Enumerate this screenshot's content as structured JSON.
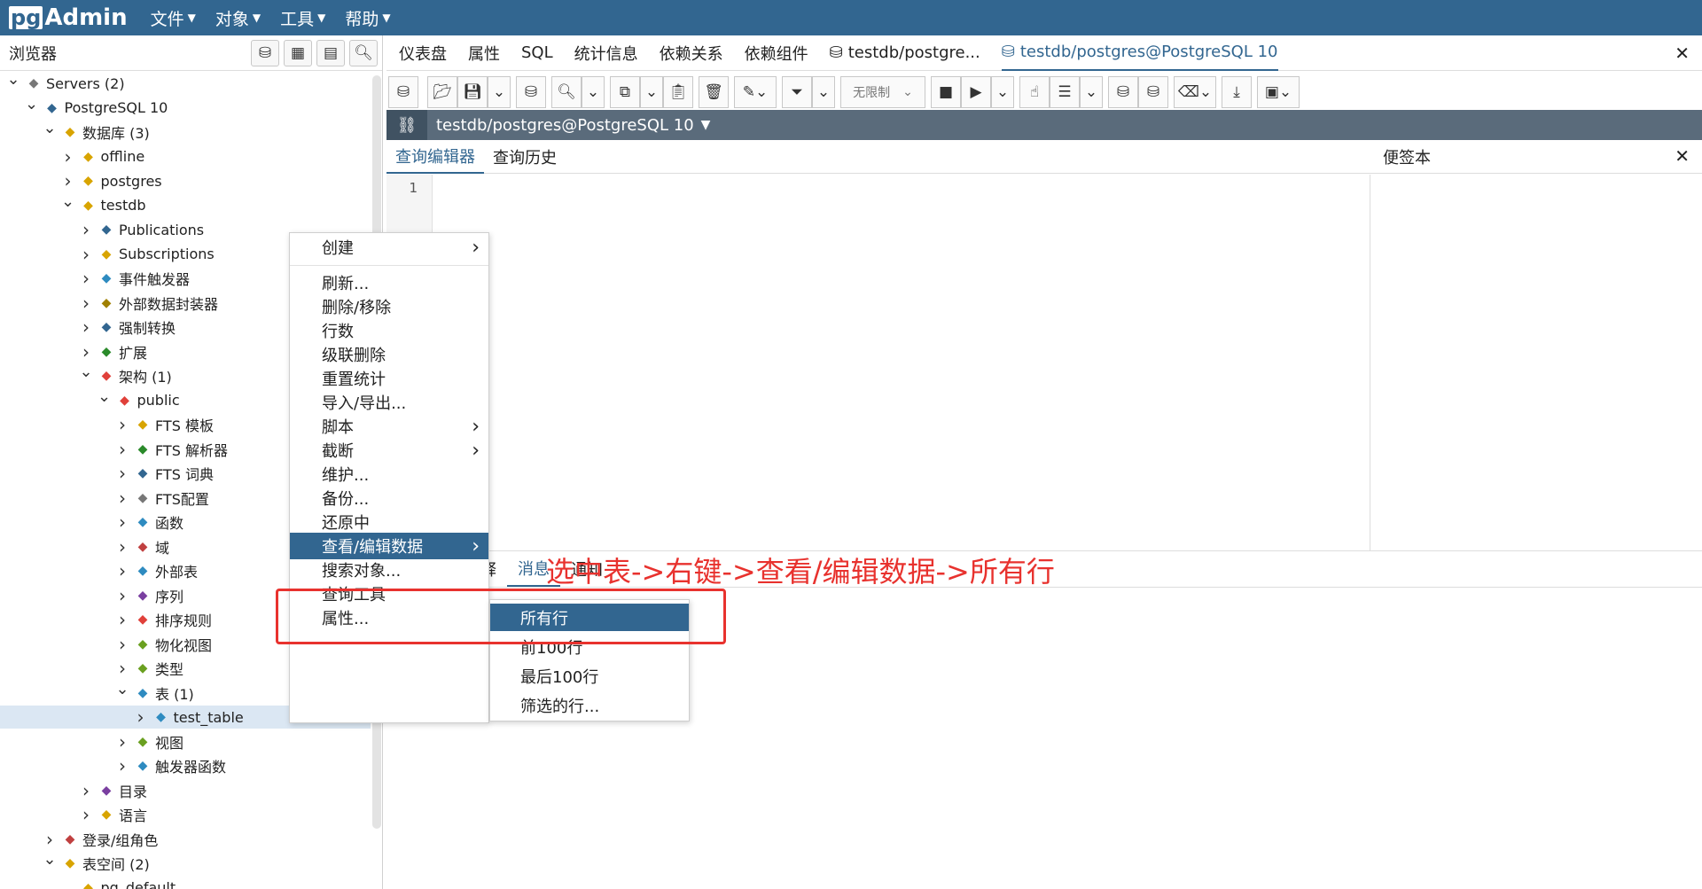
{
  "app": {
    "logo_pg": "pg",
    "logo_admin": "Admin"
  },
  "menu": [
    "文件",
    "对象",
    "工具",
    "帮助"
  ],
  "browser": {
    "title": "浏览器",
    "tree": [
      {
        "label": "Servers (2)",
        "level": 0,
        "exp": "open",
        "icon": "servers-icon",
        "color": "#777"
      },
      {
        "label": "PostgreSQL 10",
        "level": 1,
        "exp": "open",
        "icon": "elephant-icon",
        "color": "#326690"
      },
      {
        "label": "数据库 (3)",
        "level": 2,
        "exp": "open",
        "icon": "databases-icon",
        "color": "#d8a400"
      },
      {
        "label": "offline",
        "level": 3,
        "exp": "closed",
        "icon": "database-icon",
        "color": "#d8a400"
      },
      {
        "label": "postgres",
        "level": 3,
        "exp": "closed",
        "icon": "database-icon",
        "color": "#d8a400"
      },
      {
        "label": "testdb",
        "level": 3,
        "exp": "open",
        "icon": "database-icon",
        "color": "#d8a400"
      },
      {
        "label": "Publications",
        "level": 4,
        "exp": "closed",
        "icon": "publication-icon",
        "color": "#326690"
      },
      {
        "label": "Subscriptions",
        "level": 4,
        "exp": "closed",
        "icon": "subscription-icon",
        "color": "#d8a400"
      },
      {
        "label": "事件触发器",
        "level": 4,
        "exp": "closed",
        "icon": "event-trigger-icon",
        "color": "#2e8bc0"
      },
      {
        "label": "外部数据封装器",
        "level": 4,
        "exp": "closed",
        "icon": "fdw-icon",
        "color": "#a08000"
      },
      {
        "label": "强制转换",
        "level": 4,
        "exp": "closed",
        "icon": "cast-icon",
        "color": "#326690"
      },
      {
        "label": "扩展",
        "level": 4,
        "exp": "closed",
        "icon": "extension-icon",
        "color": "#2a8a2a"
      },
      {
        "label": "架构 (1)",
        "level": 4,
        "exp": "open",
        "icon": "schemas-icon",
        "color": "#e0403a"
      },
      {
        "label": "public",
        "level": 5,
        "exp": "open",
        "icon": "schema-icon",
        "color": "#e0403a"
      },
      {
        "label": "FTS 模板",
        "level": 6,
        "exp": "closed",
        "icon": "fts-template-icon",
        "color": "#d8a400"
      },
      {
        "label": "FTS 解析器",
        "level": 6,
        "exp": "closed",
        "icon": "fts-parser-icon",
        "color": "#2a8a2a"
      },
      {
        "label": "FTS 词典",
        "level": 6,
        "exp": "closed",
        "icon": "fts-dictionary-icon",
        "color": "#326690"
      },
      {
        "label": "FTS配置",
        "level": 6,
        "exp": "closed",
        "icon": "fts-config-icon",
        "color": "#777"
      },
      {
        "label": "函数",
        "level": 6,
        "exp": "closed",
        "icon": "function-icon",
        "color": "#2e8bc0"
      },
      {
        "label": "域",
        "level": 6,
        "exp": "closed",
        "icon": "domain-icon",
        "color": "#c04040"
      },
      {
        "label": "外部表",
        "level": 6,
        "exp": "closed",
        "icon": "foreign-table-icon",
        "color": "#2e8bc0"
      },
      {
        "label": "序列",
        "level": 6,
        "exp": "closed",
        "icon": "sequence-icon",
        "color": "#7a3fa0"
      },
      {
        "label": "排序规则",
        "level": 6,
        "exp": "closed",
        "icon": "collation-icon",
        "color": "#e0403a"
      },
      {
        "label": "物化视图",
        "level": 6,
        "exp": "closed",
        "icon": "materialized-view-icon",
        "color": "#6aa020"
      },
      {
        "label": "类型",
        "level": 6,
        "exp": "closed",
        "icon": "type-icon",
        "color": "#6aa020"
      },
      {
        "label": "表 (1)",
        "level": 6,
        "exp": "open",
        "icon": "tables-icon",
        "color": "#2e8bc0"
      },
      {
        "label": "test_table",
        "level": 7,
        "exp": "closed",
        "icon": "table-icon",
        "color": "#2e8bc0",
        "selected": true
      },
      {
        "label": "视图",
        "level": 6,
        "exp": "closed",
        "icon": "view-icon",
        "color": "#6aa020"
      },
      {
        "label": "触发器函数",
        "level": 6,
        "exp": "closed",
        "icon": "trigger-function-icon",
        "color": "#2e8bc0"
      },
      {
        "label": "目录",
        "level": 4,
        "exp": "closed",
        "icon": "catalog-icon",
        "color": "#7a3fa0"
      },
      {
        "label": "语言",
        "level": 4,
        "exp": "closed",
        "icon": "language-icon",
        "color": "#d8a400"
      },
      {
        "label": "登录/组角色",
        "level": 2,
        "exp": "closed",
        "icon": "roles-icon",
        "color": "#c04040"
      },
      {
        "label": "表空间 (2)",
        "level": 2,
        "exp": "open",
        "icon": "tablespaces-icon",
        "color": "#d8a400"
      },
      {
        "label": "pg_default",
        "level": 3,
        "exp": "none",
        "icon": "tablespace-icon",
        "color": "#d8a400"
      }
    ]
  },
  "tabs": [
    "仪表盘",
    "属性",
    "SQL",
    "统计信息",
    "依赖关系",
    "依赖组件",
    "testdb/postgre...",
    "testdb/postgres@PostgreSQL 10"
  ],
  "toolbar": {
    "limit_label": "无限制"
  },
  "connection": {
    "label": "testdb/postgres@PostgreSQL 10"
  },
  "query_tabs": [
    "查询编辑器",
    "查询历史"
  ],
  "scratch": {
    "title": "便签本"
  },
  "editor": {
    "line_number": "1"
  },
  "bottom_tabs": [
    "释",
    "消息",
    "通知"
  ],
  "context_menu": [
    {
      "label": "创建",
      "sub": true
    },
    {
      "label": "刷新...",
      "sub": false
    },
    {
      "label": "删除/移除",
      "sub": false
    },
    {
      "label": "行数",
      "sub": false
    },
    {
      "label": "级联删除",
      "sub": false
    },
    {
      "label": "重置统计",
      "sub": false
    },
    {
      "label": "导入/导出...",
      "sub": false
    },
    {
      "label": "脚本",
      "sub": true
    },
    {
      "label": "截断",
      "sub": true
    },
    {
      "label": "维护...",
      "sub": false
    },
    {
      "label": "备份...",
      "sub": false
    },
    {
      "label": "还原中",
      "sub": false
    },
    {
      "label": "查看/编辑数据",
      "sub": true,
      "highlight": true
    },
    {
      "label": "搜索对象...",
      "sub": false
    },
    {
      "label": "查询工具",
      "sub": false
    },
    {
      "label": "属性...",
      "sub": false
    }
  ],
  "submenu": [
    {
      "label": "所有行",
      "highlight": true
    },
    {
      "label": "前100行"
    },
    {
      "label": "最后100行"
    },
    {
      "label": "筛选的行..."
    }
  ],
  "annotation": "选中表->右键->查看/编辑数据->所有行",
  "colors": {
    "topbar": "#326690",
    "accent": "#326690",
    "annotation": "#e8322e",
    "selected_row": "#dbe7f3"
  }
}
